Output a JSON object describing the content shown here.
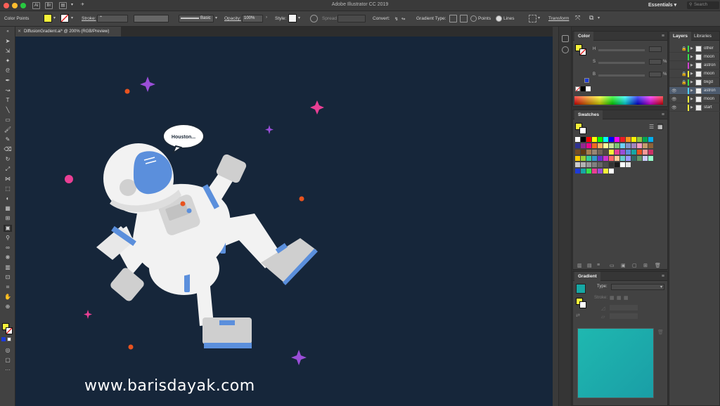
{
  "window": {
    "title": "Adobe Illustrator CC 2019",
    "workspace": "Essentials",
    "search_placeholder": "Search"
  },
  "control_bar": {
    "selection_label": "Color Points",
    "stroke_label": "Stroke:",
    "brush_label": "Basic",
    "opacity_label": "Opacity:",
    "opacity_value": "100%",
    "style_label": "Style:",
    "spread_label": "Spread",
    "convert_label": "Convert:",
    "gradient_type_label": "Gradient Type:",
    "points_label": "Points",
    "lines_label": "Lines",
    "transform_label": "Transform",
    "fill_color": "#f7f23a"
  },
  "document": {
    "tab_label": "DiffusionGradient.ai* @ 200% (RGB/Preview)",
    "speech_text": "Houston...",
    "watermark": "www.barisdayak.com",
    "background_color": "#16263a"
  },
  "panels": {
    "color": {
      "title": "Color",
      "channels": [
        "H",
        "S",
        "B"
      ],
      "percent": "%"
    },
    "swatches": {
      "title": "Swatches"
    },
    "gradient": {
      "title": "Gradient",
      "type_label": "Type:",
      "stroke_label": "Stroke:"
    },
    "layers": {
      "tabs": [
        "Layers",
        "Libraries"
      ],
      "items": [
        {
          "name": "other",
          "color": "#36e34a",
          "locked": true,
          "visible": false
        },
        {
          "name": "moon",
          "color": "#36e34a",
          "locked": false,
          "visible": false
        },
        {
          "name": "astron",
          "color": "#d040d0",
          "locked": false,
          "visible": false
        },
        {
          "name": "moon",
          "color": "#f7f23a",
          "locked": true,
          "visible": false
        },
        {
          "name": "bkgd",
          "color": "#36e34a",
          "locked": true,
          "visible": false
        },
        {
          "name": "astron",
          "color": "#4fd0ff",
          "locked": false,
          "visible": true
        },
        {
          "name": "moon",
          "color": "#f7f23a",
          "locked": false,
          "visible": true
        },
        {
          "name": "start",
          "color": "#f7f23a",
          "locked": false,
          "visible": true
        }
      ]
    }
  },
  "icons": {
    "close": "close-icon",
    "eye": "eye-icon",
    "lock": "lock-icon",
    "menu": "panel-menu-icon"
  }
}
